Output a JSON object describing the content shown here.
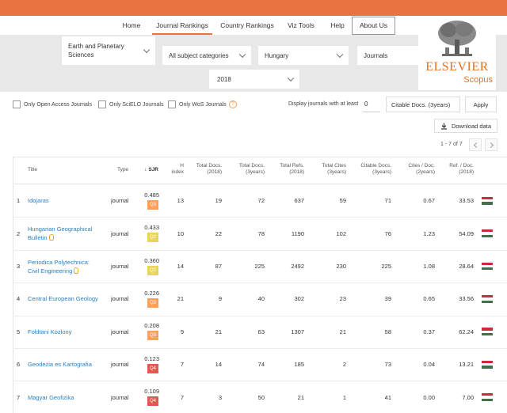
{
  "nav": {
    "items": [
      "Home",
      "Journal Rankings",
      "Country Rankings",
      "Viz Tools",
      "Help",
      "About Us"
    ],
    "active": "Journal Rankings"
  },
  "filters": {
    "subject_area": "Earth and Planetary Sciences",
    "category": "All subject categories",
    "country": "Hungary",
    "type": "Journals",
    "year": "2018"
  },
  "logo": {
    "brand": "ELSEVIER",
    "product": "Scopus"
  },
  "options": {
    "open_access": "Only Open Access Journals",
    "scielo": "Only SciELO Journals",
    "wos": "Only WoS Journals",
    "help_icon": "?",
    "display_label": "Display journals with at least",
    "display_value": "0",
    "citable_select": "Citable Docs. (3years)",
    "apply": "Apply",
    "download": "Download data",
    "download_icon": "download-icon"
  },
  "pager": {
    "text": "1 - 7 of 7"
  },
  "table": {
    "headers": {
      "title": "Title",
      "type": "Type",
      "sjr": "↓ SJR",
      "h_index": [
        "H",
        "index"
      ],
      "total_docs_2018": [
        "Total Docs.",
        "(2018)"
      ],
      "total_docs_3y": [
        "Total Docs.",
        "(3years)"
      ],
      "total_refs": [
        "Total Refs.",
        "(2018)"
      ],
      "total_cites": [
        "Total Cites",
        "(3years)"
      ],
      "citable_docs": [
        "Citable Docs.",
        "(3years)"
      ],
      "cites_per_doc": [
        "Cites / Doc.",
        "(2years)"
      ],
      "ref_per_doc": [
        "Ref. / Doc.",
        "(2018)"
      ]
    },
    "quartile_colors": {
      "Q2": "#e8d559",
      "Q3": "#fba05f",
      "Q4": "#dd5a4e"
    },
    "flag_colors": [
      "#cd2a3e",
      "#ffffff",
      "#436f4d"
    ],
    "rows": [
      {
        "rank": "1",
        "title": [
          "Idojaras"
        ],
        "open_access": false,
        "type": "journal",
        "sjr": "0.485",
        "quartile": "Q3",
        "h": "13",
        "docs2018": "19",
        "docs3y": "72",
        "refs": "637",
        "cites": "59",
        "citable": "71",
        "cpd": "0.67",
        "rpd": "33.53"
      },
      {
        "rank": "2",
        "title": [
          "Hungarian Geographical",
          "Bulletin"
        ],
        "open_access": true,
        "type": "journal",
        "sjr": "0.433",
        "quartile": "Q2",
        "h": "10",
        "docs2018": "22",
        "docs3y": "78",
        "refs": "1190",
        "cites": "102",
        "citable": "76",
        "cpd": "1.23",
        "rpd": "54.09"
      },
      {
        "rank": "3",
        "title": [
          "Periodica Polytechnica:",
          "Civil Engineering"
        ],
        "open_access": true,
        "type": "journal",
        "sjr": "0.360",
        "quartile": "Q2",
        "h": "14",
        "docs2018": "87",
        "docs3y": "225",
        "refs": "2492",
        "cites": "230",
        "citable": "225",
        "cpd": "1.08",
        "rpd": "28.64"
      },
      {
        "rank": "4",
        "title": [
          "Central European Geology"
        ],
        "open_access": false,
        "type": "journal",
        "sjr": "0.226",
        "quartile": "Q3",
        "h": "21",
        "docs2018": "9",
        "docs3y": "40",
        "refs": "302",
        "cites": "23",
        "citable": "39",
        "cpd": "0.65",
        "rpd": "33.56"
      },
      {
        "rank": "5",
        "title": [
          "Foldtani Kozlony"
        ],
        "open_access": false,
        "type": "journal",
        "sjr": "0.208",
        "quartile": "Q3",
        "h": "9",
        "docs2018": "21",
        "docs3y": "63",
        "refs": "1307",
        "cites": "21",
        "citable": "58",
        "cpd": "0.37",
        "rpd": "62.24"
      },
      {
        "rank": "6",
        "title": [
          "Geodezia es Kartografia"
        ],
        "open_access": false,
        "type": "journal",
        "sjr": "0.123",
        "quartile": "Q4",
        "h": "7",
        "docs2018": "14",
        "docs3y": "74",
        "refs": "185",
        "cites": "2",
        "citable": "73",
        "cpd": "0.04",
        "rpd": "13.21"
      },
      {
        "rank": "7",
        "title": [
          "Magyar Geofizika"
        ],
        "open_access": false,
        "type": "journal",
        "sjr": "0.109",
        "quartile": "Q4",
        "h": "7",
        "docs2018": "3",
        "docs3y": "50",
        "refs": "21",
        "cites": "1",
        "citable": "41",
        "cpd": "0.00",
        "rpd": "7.00"
      }
    ]
  }
}
